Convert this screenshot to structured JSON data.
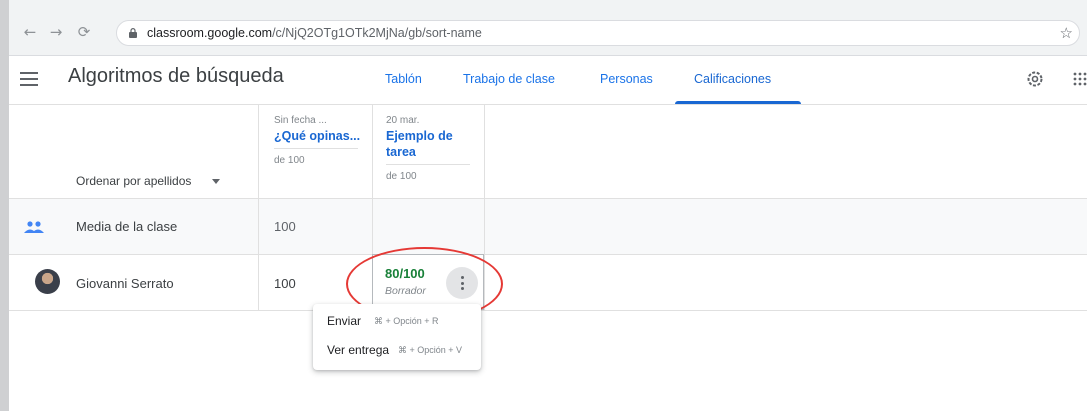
{
  "browser": {
    "url_host": "classroom.google.com",
    "url_path": "/c/NjQ2OTg1OTk2MjNa/gb/sort-name",
    "back_icon": "arrow-left-icon",
    "forward_icon": "arrow-right-icon",
    "reload_icon": "reload-icon"
  },
  "header": {
    "course_title": "Algoritmos de búsqueda",
    "tabs": [
      {
        "label": "Tablón"
      },
      {
        "label": "Trabajo de clase"
      },
      {
        "label": "Personas"
      },
      {
        "label": "Calificaciones",
        "active": true
      }
    ]
  },
  "gradebook": {
    "sort_label": "Ordenar por apellidos",
    "columns": [
      {
        "date": "Sin fecha ...",
        "title": "¿Qué opinas...",
        "max": "de 100"
      },
      {
        "date": "20 mar.",
        "title": "Ejemplo de tarea",
        "max": "de 100"
      }
    ],
    "average_row": {
      "label": "Media de la clase",
      "values": [
        "100",
        ""
      ]
    },
    "students": [
      {
        "name": "Giovanni Serrato",
        "grades": [
          "100",
          "80/100"
        ],
        "status": "Borrador"
      }
    ]
  },
  "context_menu": {
    "items": [
      {
        "label": "Enviar",
        "shortcut": "⌘ + Opción + R"
      },
      {
        "label": "Ver entrega",
        "shortcut": "⌘ + Opción + V"
      }
    ]
  },
  "colors": {
    "accent": "#1967d2",
    "grade_green": "#188038",
    "highlight_red": "#e53935"
  }
}
